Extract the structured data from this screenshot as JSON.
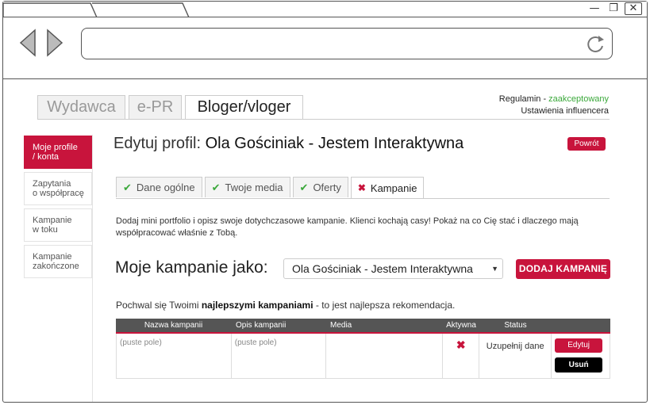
{
  "main_tabs": [
    {
      "label": "Wydawca",
      "active": false
    },
    {
      "label": "e-PR",
      "active": false
    },
    {
      "label": "Bloger/vloger",
      "active": true
    }
  ],
  "top_right": {
    "regulamin": "Regulamin",
    "separator": " - ",
    "status": "zaakceptowany",
    "settings": "Ustawienia influencera"
  },
  "sidebar": {
    "items": [
      {
        "line1": "Moje profile",
        "line2": "/ konta",
        "active": true
      },
      {
        "line1": "Zapytania",
        "line2": "o współpracę",
        "active": false
      },
      {
        "line1": "Kampanie",
        "line2": "w toku",
        "active": false
      },
      {
        "line1": "Kampanie",
        "line2": "zakończone",
        "active": false
      }
    ]
  },
  "header": {
    "prefix": "Edytuj profil: ",
    "name": "Ola Gościniak - Jestem Interaktywna",
    "back": "Powrót"
  },
  "sub_tabs": [
    {
      "label": "Dane ogólne",
      "icon": "check-icon"
    },
    {
      "label": "Twoje media",
      "icon": "check-icon"
    },
    {
      "label": "Oferty",
      "icon": "check-icon"
    },
    {
      "label": "Kampanie",
      "icon": "x-icon",
      "active": true
    }
  ],
  "description": "Dodaj mini portfolio i opisz swoje dotychczasowe kampanie. Klienci kochają casy! Pokaż na co Cię stać i dlaczego mają współpracować właśnie z Tobą.",
  "campaigns": {
    "label": "Moje kampanie jako:",
    "select_value": "Ola Gościniak - Jestem Interaktywna",
    "add_button": "DODAJ KAMPANIĘ"
  },
  "praise": {
    "before": "Pochwal się Twoimi ",
    "bold": "najlepszymi kampaniami",
    "after": " - to jest najlepsza rekomendacja."
  },
  "table": {
    "headers": [
      "Nazwa kampanii",
      "Opis kampanii",
      "Media",
      "Aktywna",
      "Status",
      ""
    ],
    "row": {
      "name": "(puste pole)",
      "description": "(puste pole)",
      "media": "",
      "active_icon": "x-icon",
      "status": "Uzupełnij dane",
      "edit": "Edytuj",
      "delete": "Usuń"
    }
  },
  "colors": {
    "accent": "#c8143c",
    "ok": "#3aa83a",
    "header_dark": "#555555"
  }
}
